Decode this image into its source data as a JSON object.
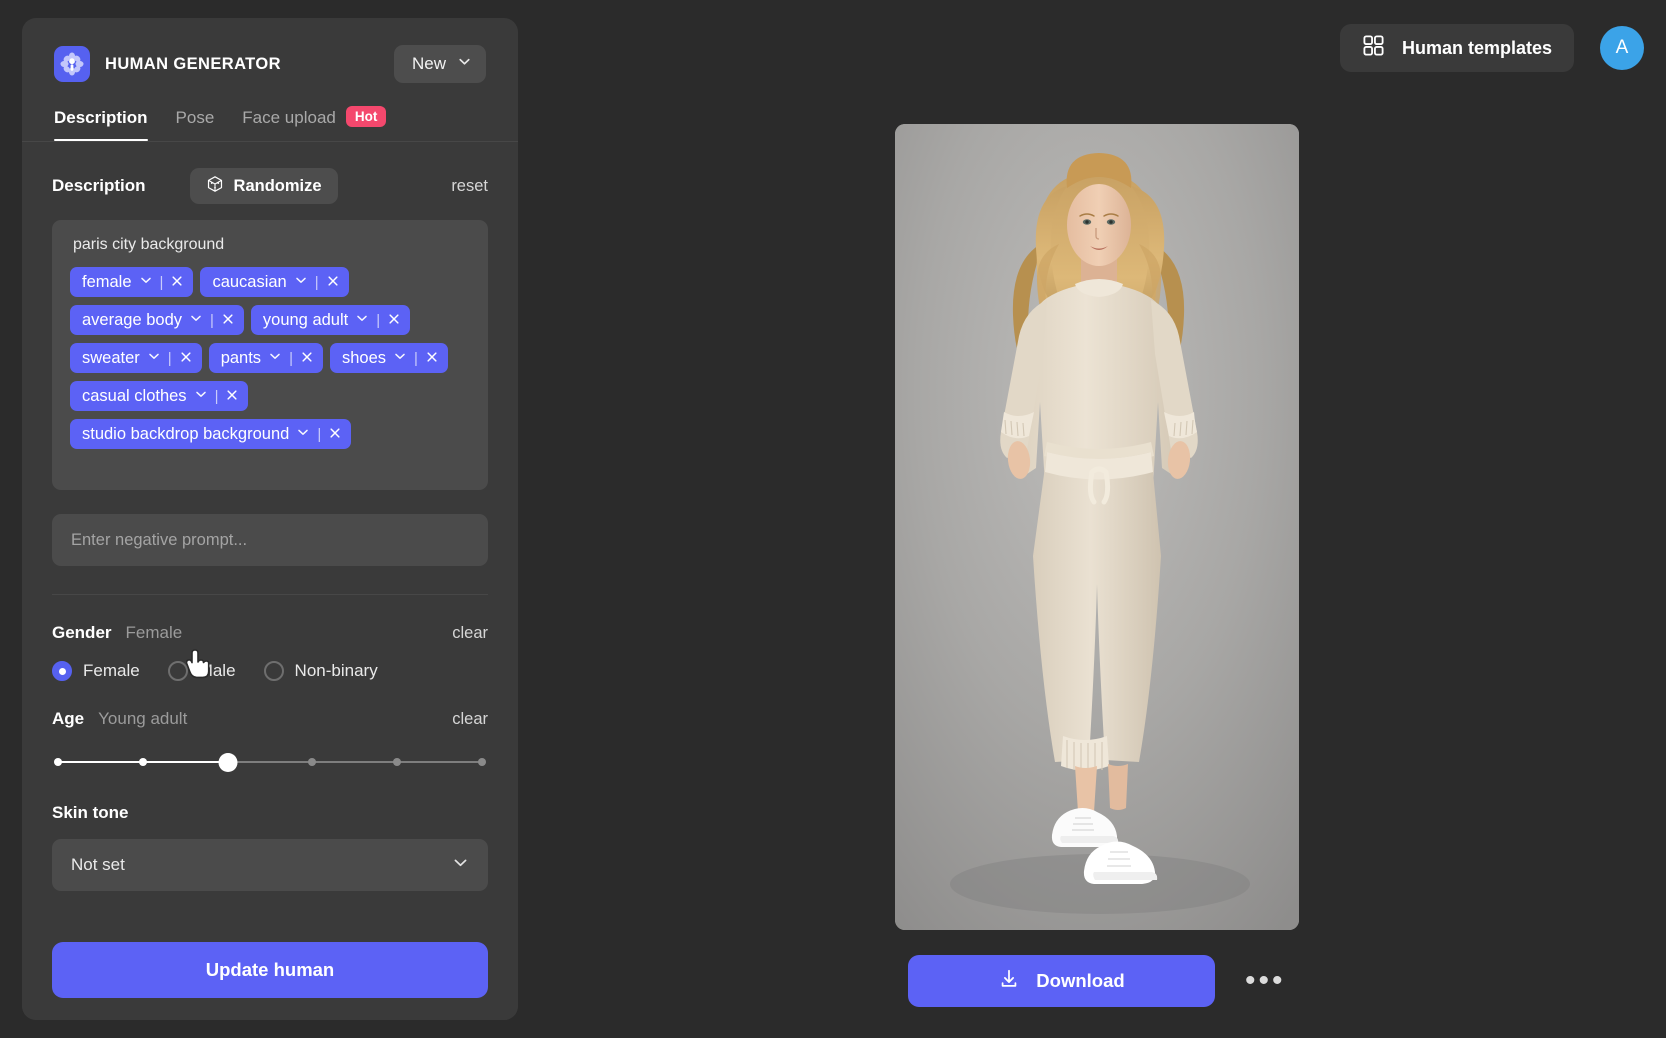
{
  "app": {
    "brand_name": "HUMAN GENERATOR",
    "logo_icon": "flower-petals-icon",
    "new_button": "New",
    "new_caret_icon": "chevron-down-icon"
  },
  "tabs": [
    {
      "label": "Description",
      "active": true
    },
    {
      "label": "Pose",
      "active": false
    },
    {
      "label": "Face upload",
      "active": false,
      "badge": "Hot"
    }
  ],
  "description": {
    "section_title": "Description",
    "randomize_label": "Randomize",
    "randomize_icon": "dice-cube-icon",
    "reset_label": "reset",
    "free_text": "paris city background",
    "tags": [
      "female",
      "caucasian",
      "average body",
      "young adult",
      "sweater",
      "pants",
      "shoes",
      "casual clothes",
      "studio backdrop background"
    ],
    "tag_caret_icon": "chevron-down-icon",
    "tag_remove_icon": "close-icon",
    "negative_prompt_value": "",
    "negative_prompt_placeholder": "Enter negative prompt..."
  },
  "gender": {
    "label": "Gender",
    "value": "Female",
    "clear_label": "clear",
    "options": [
      {
        "label": "Female",
        "selected": true
      },
      {
        "label": "Male",
        "selected": false
      },
      {
        "label": "Non-binary",
        "selected": false
      }
    ]
  },
  "age": {
    "label": "Age",
    "value": "Young adult",
    "clear_label": "clear",
    "steps": 6,
    "selected_index": 2
  },
  "skin_tone": {
    "label": "Skin tone",
    "value": "Not set",
    "caret_icon": "chevron-down-icon"
  },
  "footer": {
    "update_label": "Update human"
  },
  "topbar": {
    "templates_label": "Human templates",
    "templates_icon": "grid-2x2-icon",
    "avatar_initial": "A"
  },
  "preview": {
    "download_label": "Download",
    "download_icon": "download-arrow-icon",
    "more_icon": "ellipsis-icon",
    "image_alt": "generated human: blonde woman in cream knit sweater and joggers with white sneakers on grey studio backdrop"
  },
  "colors": {
    "accent_purple": "#5c62f5",
    "badge_pink": "#f4486d",
    "avatar_blue": "#3ba3e8",
    "panel_bg": "#3a3a3a",
    "field_bg": "#4b4b4b",
    "page_bg": "#2b2b2b"
  }
}
